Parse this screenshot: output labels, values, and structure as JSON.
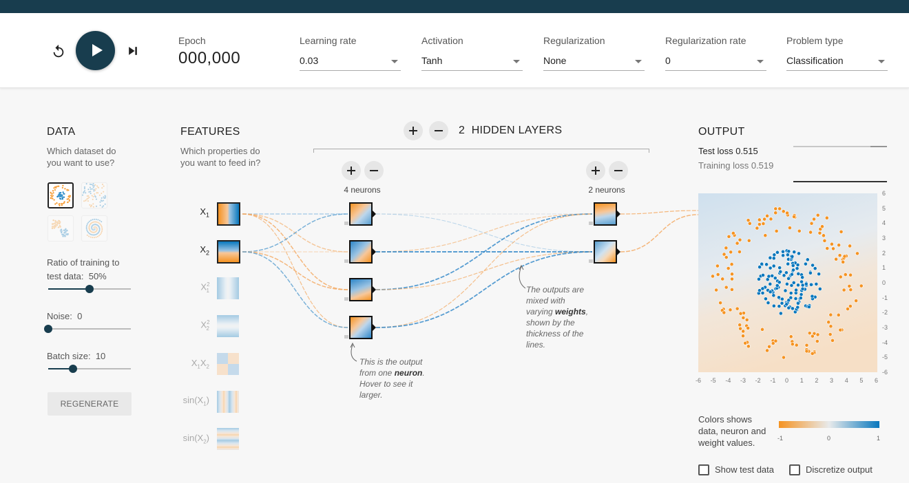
{
  "controls": {
    "epoch_label": "Epoch",
    "epoch_value": "000,000",
    "learning_rate": {
      "label": "Learning rate",
      "value": "0.03"
    },
    "activation": {
      "label": "Activation",
      "value": "Tanh"
    },
    "regularization": {
      "label": "Regularization",
      "value": "None"
    },
    "regularization_rate": {
      "label": "Regularization rate",
      "value": "0"
    },
    "problem_type": {
      "label": "Problem type",
      "value": "Classification"
    }
  },
  "data_panel": {
    "title": "DATA",
    "subtitle_line1": "Which dataset do",
    "subtitle_line2": "you want to use?",
    "datasets": [
      "circle",
      "xor",
      "gaussian",
      "spiral"
    ],
    "selected_dataset": "circle",
    "ratio_label_line1": "Ratio of training to",
    "ratio_label_line2": "test data:",
    "ratio_value": "50%",
    "ratio_fraction": 0.5,
    "noise_label": "Noise:",
    "noise_value": "0",
    "noise_fraction": 0.0,
    "batch_label": "Batch size:",
    "batch_value": "10",
    "batch_fraction": 0.3,
    "regenerate_label": "REGENERATE"
  },
  "features_panel": {
    "title": "FEATURES",
    "subtitle_line1": "Which properties do",
    "subtitle_line2": "you want to feed in?",
    "features": [
      {
        "name": "X",
        "sub": "1",
        "sup": "",
        "active": true
      },
      {
        "name": "X",
        "sub": "2",
        "sup": "",
        "active": true
      },
      {
        "name": "X",
        "sub": "1",
        "sup": "2",
        "active": false
      },
      {
        "name": "X",
        "sub": "2",
        "sup": "2",
        "active": false
      },
      {
        "name": "X1X2",
        "sub": "",
        "sup": "",
        "active": false
      },
      {
        "name": "sin(X1)",
        "sub": "",
        "sup": "",
        "active": false
      },
      {
        "name": "sin(X2)",
        "sub": "",
        "sup": "",
        "active": false
      }
    ]
  },
  "network": {
    "hidden_layers_count": "2",
    "hidden_layers_label": "HIDDEN LAYERS",
    "layers": [
      {
        "neurons_label": "4 neurons"
      },
      {
        "neurons_label": "2 neurons"
      }
    ]
  },
  "annotations": {
    "neuron_note": {
      "pre": "This is the output from one",
      "bold": "neuron",
      "post": ". Hover to see it larger."
    },
    "weights_note": {
      "pre": "The outputs are mixed with varying",
      "bold": "weights",
      "post": ", shown by the thickness of the lines."
    }
  },
  "output_panel": {
    "title": "OUTPUT",
    "test_loss_label": "Test loss",
    "test_loss_value": "0.515",
    "training_loss_label": "Training loss",
    "training_loss_value": "0.519",
    "x_ticks": [
      "-6",
      "-5",
      "-4",
      "-3",
      "-2",
      "-1",
      "0",
      "1",
      "2",
      "3",
      "4",
      "5",
      "6"
    ],
    "y_ticks": [
      "6",
      "5",
      "4",
      "3",
      "2",
      "1",
      "0",
      "-1",
      "-2",
      "-3",
      "-4",
      "-5",
      "-6"
    ],
    "legend_text": "Colors shows data, neuron and weight values.",
    "legend_ticks": [
      "-1",
      "0",
      "1"
    ],
    "show_test_data_label": "Show test data",
    "show_test_data_checked": false,
    "discretize_label": "Discretize output",
    "discretize_checked": false
  },
  "colors": {
    "orange": "#f59322",
    "blue": "#0877bd",
    "neutral": "#e8eaeb",
    "navy": "#183d4e"
  }
}
